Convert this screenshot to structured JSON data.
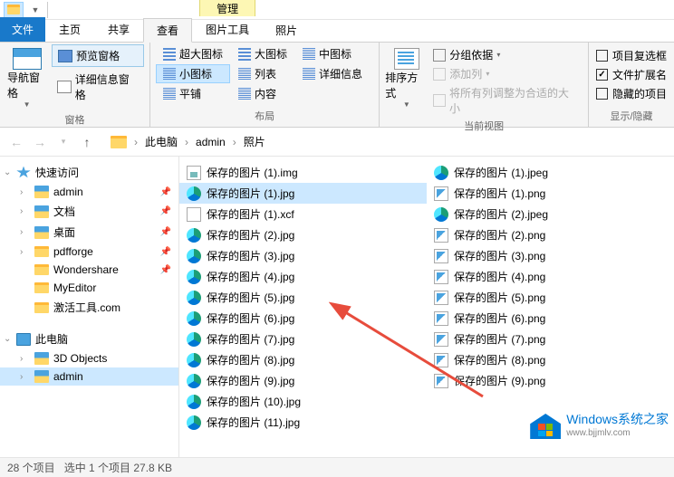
{
  "tabs": {
    "file": "文件",
    "home": "主页",
    "share": "共享",
    "view": "查看",
    "context_group": "管理",
    "context_tab": "图片工具",
    "after": "照片"
  },
  "ribbon": {
    "panes": {
      "nav": "导航窗格",
      "preview": "预览窗格",
      "details": "详细信息窗格",
      "label": "窗格"
    },
    "layout": {
      "extra_large": "超大图标",
      "large": "大图标",
      "medium": "中图标",
      "small": "小图标",
      "list": "列表",
      "details": "详细信息",
      "tiles": "平铺",
      "content": "内容",
      "label": "布局"
    },
    "view": {
      "sort": "排序方式",
      "group": "分组依据",
      "addcol": "添加列",
      "fitcols": "将所有列调整为合适的大小",
      "label": "当前视图"
    },
    "showhide": {
      "checkboxes": "项目复选框",
      "extensions": "文件扩展名",
      "hidden": "隐藏的项目",
      "label": "显示/隐藏"
    }
  },
  "breadcrumb": [
    "此电脑",
    "admin",
    "照片"
  ],
  "sidebar": {
    "quick": "快速访问",
    "items": [
      {
        "label": "admin",
        "icon": "folder-blue",
        "pin": true
      },
      {
        "label": "文档",
        "icon": "folder-blue",
        "pin": true
      },
      {
        "label": "桌面",
        "icon": "folder-blue",
        "pin": true
      },
      {
        "label": "pdfforge",
        "icon": "folder",
        "pin": true
      },
      {
        "label": "Wondershare",
        "icon": "folder",
        "pin": true
      },
      {
        "label": "MyEditor",
        "icon": "folder",
        "pin": false
      },
      {
        "label": "激活工具.com",
        "icon": "folder",
        "pin": false
      }
    ],
    "thispc": "此电脑",
    "pcitems": [
      {
        "label": "3D Objects",
        "icon": "folder-blue"
      },
      {
        "label": "admin",
        "icon": "folder-blue"
      }
    ]
  },
  "files_col1": [
    {
      "name": "保存的图片 (1).img",
      "icon": "img"
    },
    {
      "name": "保存的图片 (1).jpg",
      "icon": "edge",
      "selected": true
    },
    {
      "name": "保存的图片 (1).xcf",
      "icon": "xcf"
    },
    {
      "name": "保存的图片 (2).jpg",
      "icon": "edge"
    },
    {
      "name": "保存的图片 (3).jpg",
      "icon": "edge"
    },
    {
      "name": "保存的图片 (4).jpg",
      "icon": "edge"
    },
    {
      "name": "保存的图片 (5).jpg",
      "icon": "edge"
    },
    {
      "name": "保存的图片 (6).jpg",
      "icon": "edge"
    },
    {
      "name": "保存的图片 (7).jpg",
      "icon": "edge"
    },
    {
      "name": "保存的图片 (8).jpg",
      "icon": "edge"
    },
    {
      "name": "保存的图片 (9).jpg",
      "icon": "edge"
    },
    {
      "name": "保存的图片 (10).jpg",
      "icon": "edge"
    },
    {
      "name": "保存的图片 (11).jpg",
      "icon": "edge"
    }
  ],
  "files_col2": [
    {
      "name": "保存的图片 (1).jpeg",
      "icon": "edge"
    },
    {
      "name": "保存的图片 (1).png",
      "icon": "png"
    },
    {
      "name": "保存的图片 (2).jpeg",
      "icon": "edge"
    },
    {
      "name": "保存的图片 (2).png",
      "icon": "png"
    },
    {
      "name": "保存的图片 (3).png",
      "icon": "png"
    },
    {
      "name": "保存的图片 (4).png",
      "icon": "png"
    },
    {
      "name": "保存的图片 (5).png",
      "icon": "png"
    },
    {
      "name": "保存的图片 (6).png",
      "icon": "png"
    },
    {
      "name": "保存的图片 (7).png",
      "icon": "png"
    },
    {
      "name": "保存的图片 (8).png",
      "icon": "png"
    },
    {
      "name": "保存的图片 (9).png",
      "icon": "png"
    }
  ],
  "status": {
    "count": "28 个项目",
    "selection": "选中 1 个项目  27.8 KB"
  },
  "watermark": {
    "title": "Windows系统之家",
    "url": "www.bjjmlv.com"
  }
}
